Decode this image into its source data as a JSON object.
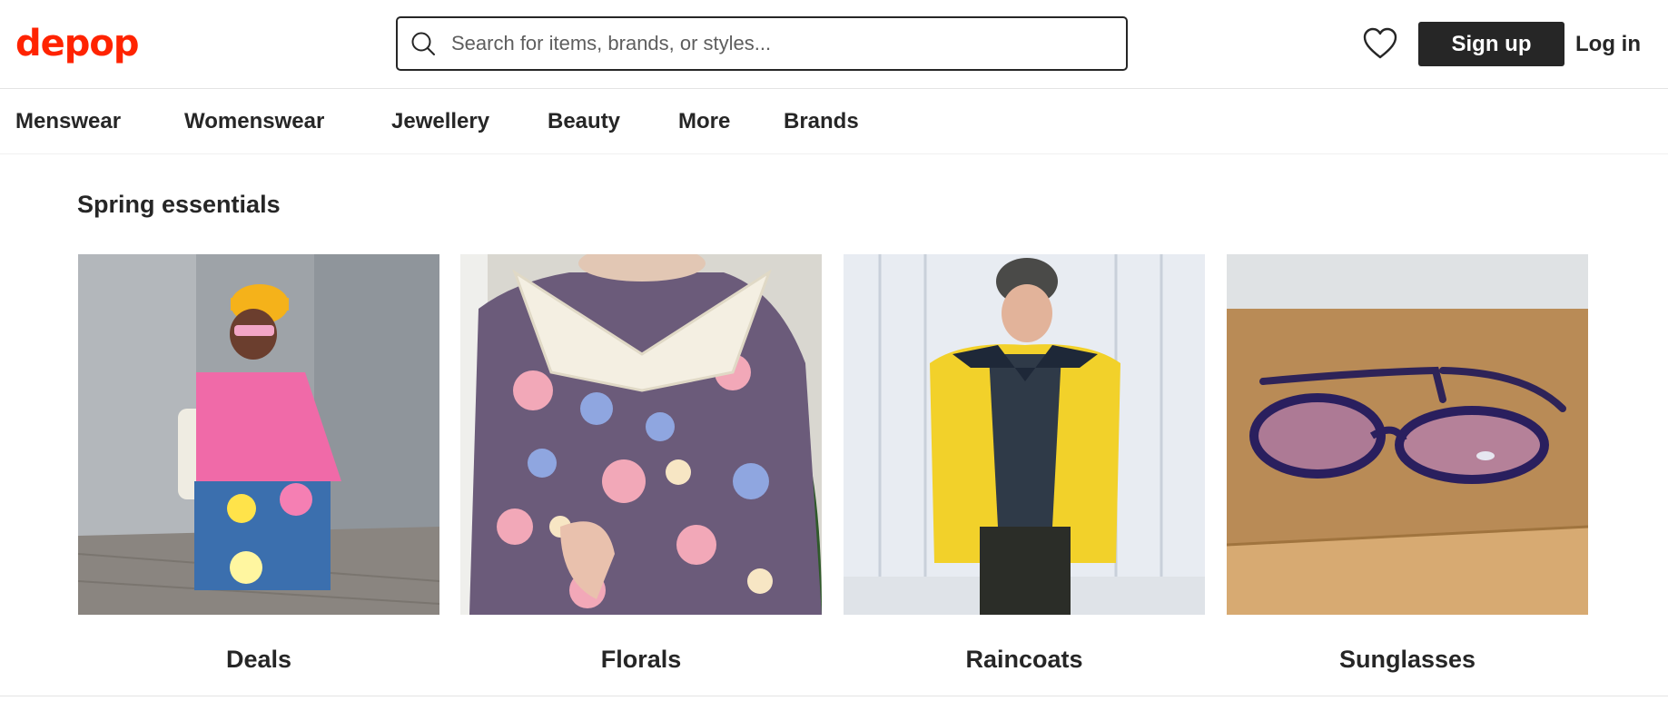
{
  "header": {
    "logo_text": "depop",
    "search_placeholder": "Search for items, brands, or styles...",
    "search_icon": "search-icon",
    "saved_icon": "heart-icon",
    "signup_label": "Sign up",
    "login_label": "Log in",
    "brand_color": "#ff2300"
  },
  "nav": {
    "items": [
      "Menswear",
      "Womenswear",
      "Jewellery",
      "Beauty",
      "More",
      "Brands"
    ]
  },
  "section": {
    "title": "Spring essentials",
    "cards": [
      {
        "label": "Deals"
      },
      {
        "label": "Florals"
      },
      {
        "label": "Raincoats"
      },
      {
        "label": "Sunglasses"
      }
    ]
  }
}
